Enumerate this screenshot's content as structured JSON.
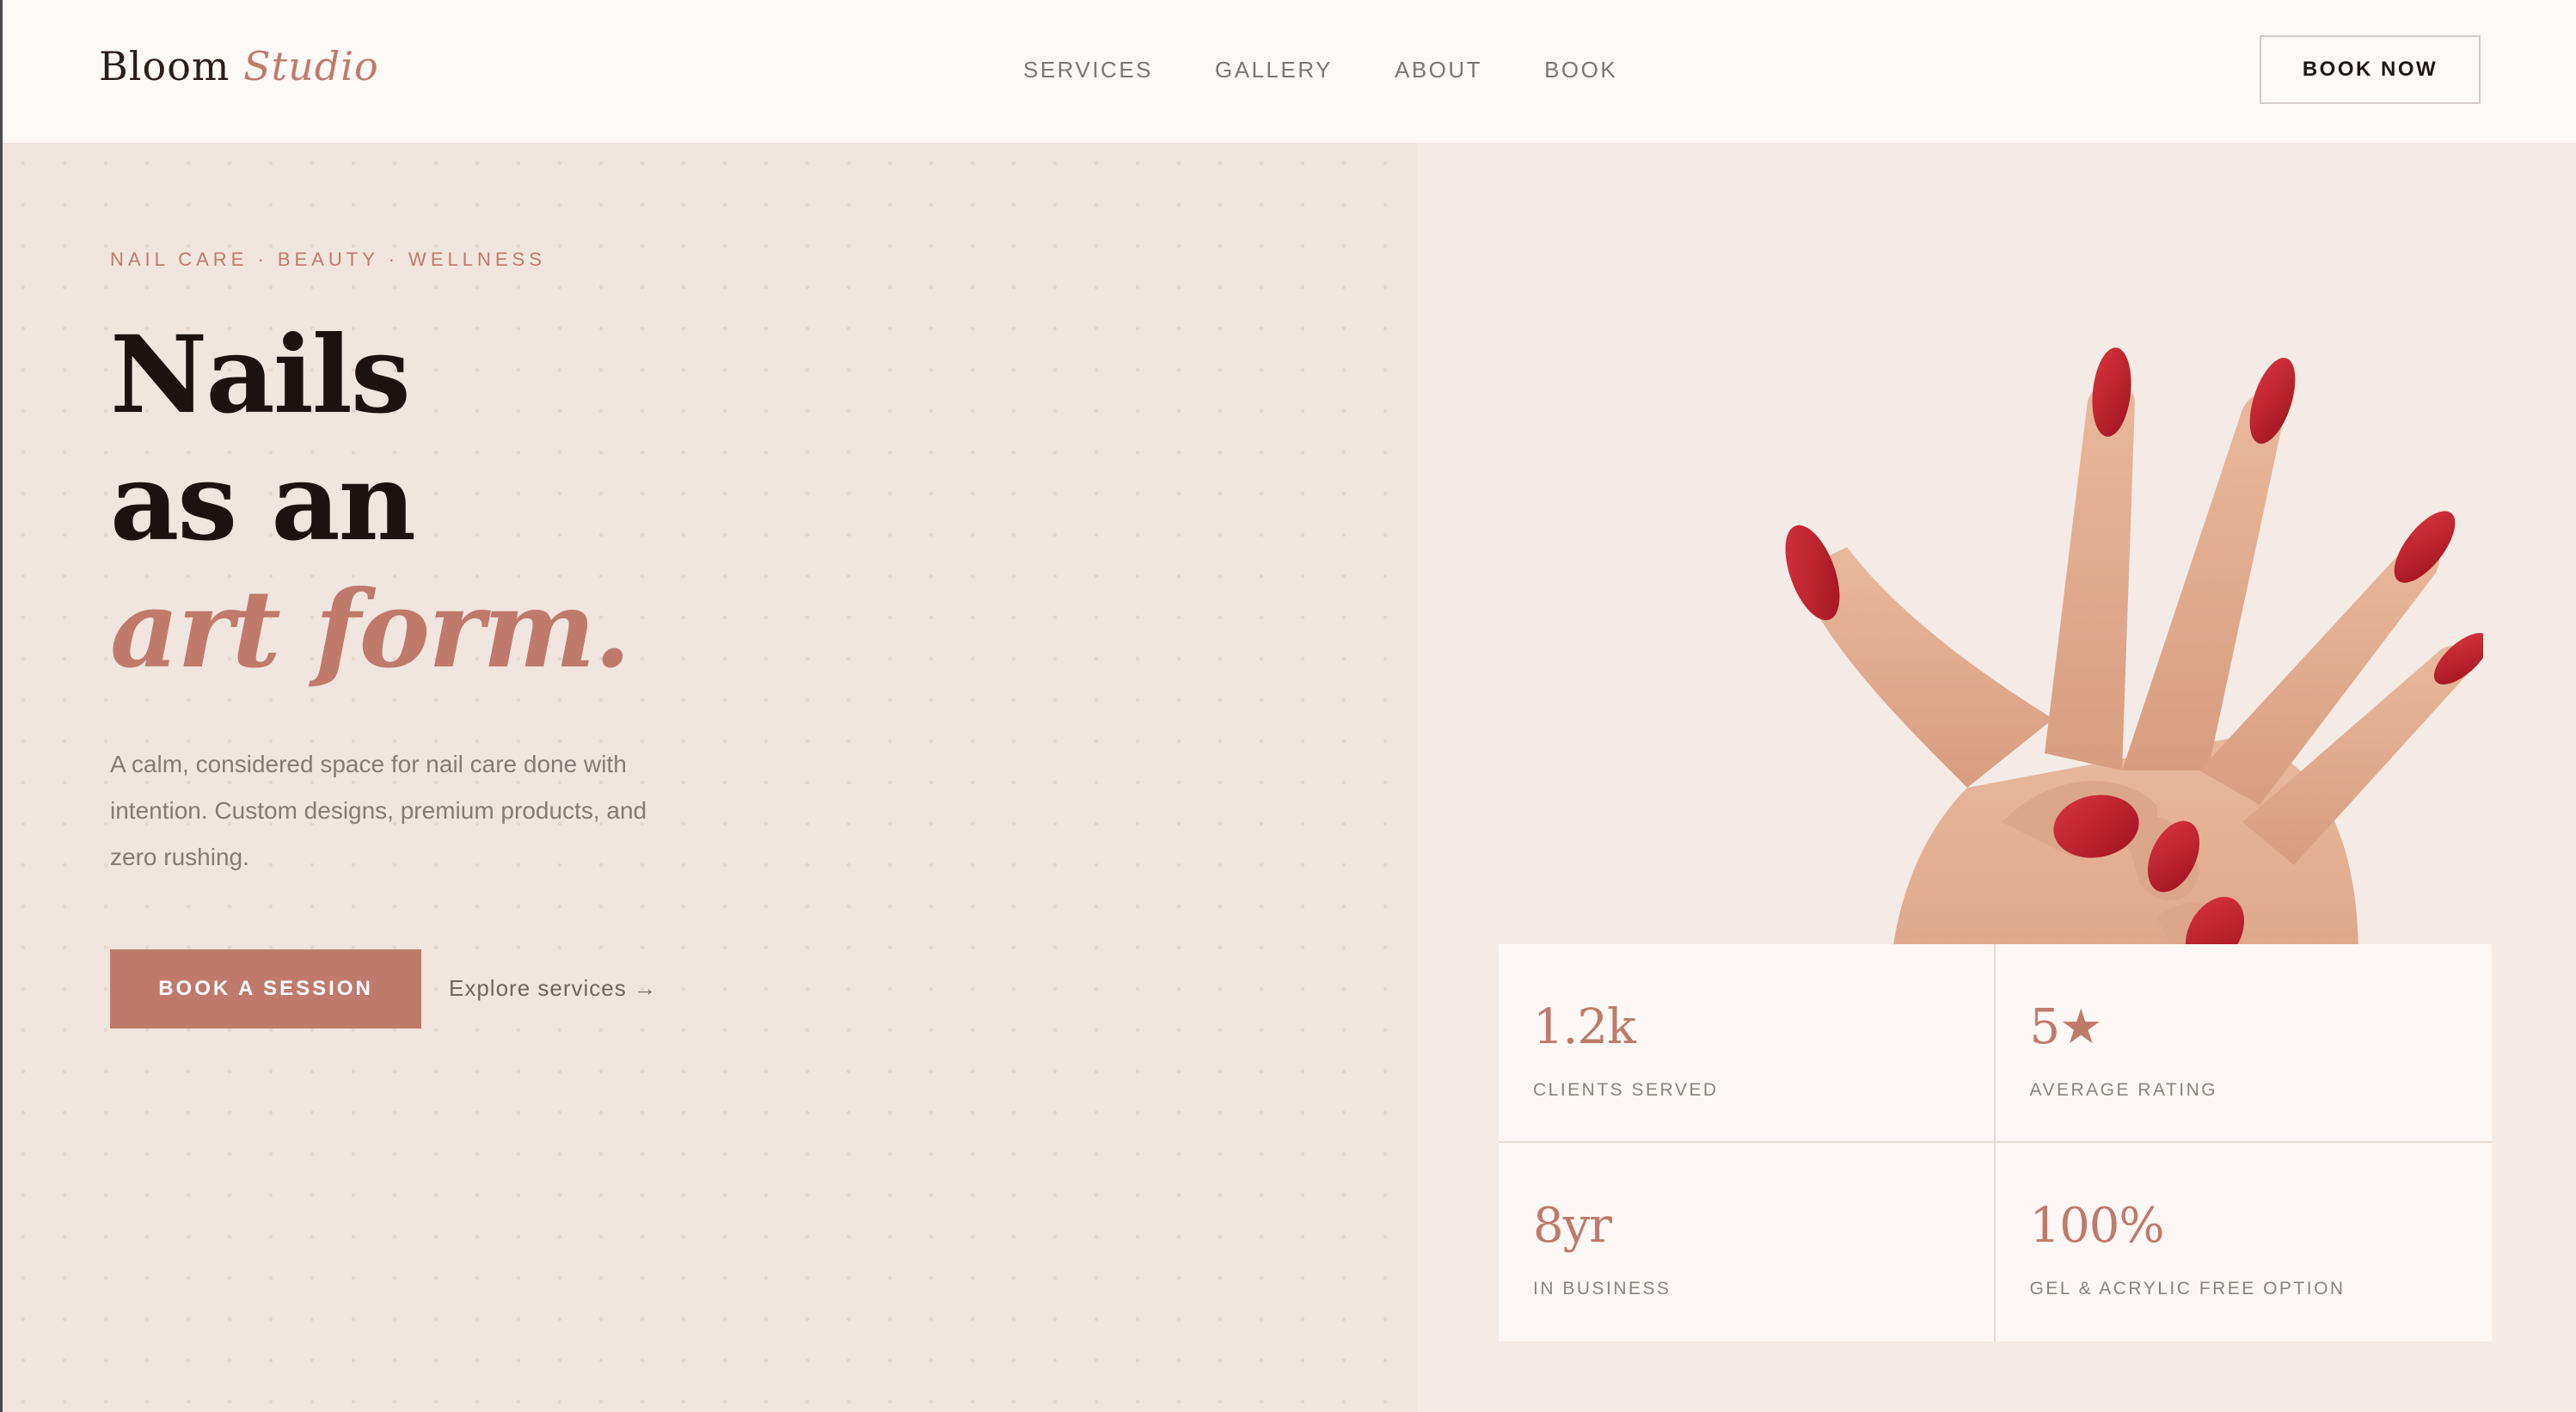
{
  "header": {
    "logo_main": "Bloom",
    "logo_accent": "Studio",
    "nav": [
      "SERVICES",
      "GALLERY",
      "ABOUT",
      "BOOK"
    ],
    "cta_label": "BOOK NOW"
  },
  "hero": {
    "eyebrow": "NAIL CARE · BEAUTY · WELLNESS",
    "headline_line1": "Nails",
    "headline_line2": "as an",
    "headline_line3": "art form.",
    "lede": "A calm, considered space for nail care done with intention. Custom designs, premium products, and zero rushing.",
    "primary_cta": "BOOK A SESSION",
    "secondary_cta": "Explore services →"
  },
  "stats": [
    {
      "value": "1.2k",
      "label": "CLIENTS SERVED"
    },
    {
      "value": "5★",
      "label": "AVERAGE RATING"
    },
    {
      "value": "8yr",
      "label": "IN BUSINESS"
    },
    {
      "value": "100%",
      "label": "GEL & ACRYLIC FREE OPTION"
    }
  ],
  "colors": {
    "accent": "#c07a6c",
    "nail_red": "#b81c28",
    "background": "#f2e6e0",
    "header_bg": "#fdf9f7",
    "text_dark": "#1c1311"
  },
  "icons": {
    "secondary_cta_arrow": "arrow-right-icon"
  }
}
